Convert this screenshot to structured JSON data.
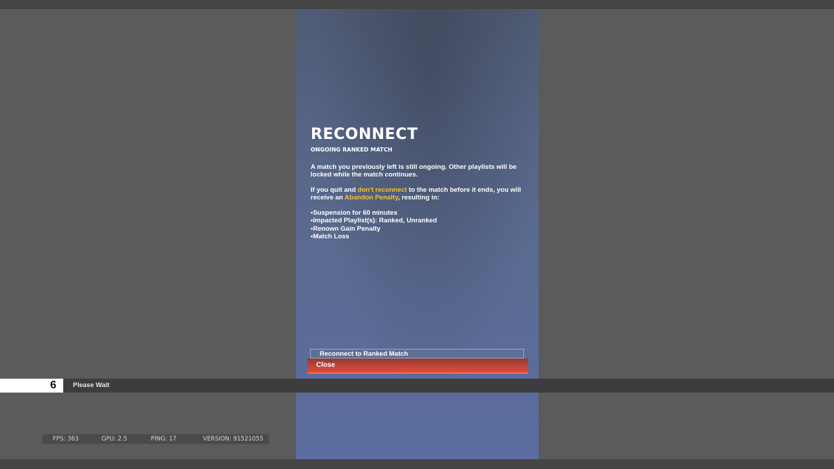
{
  "dialog": {
    "title": "RECONNECT",
    "subtitle": "ONGOING RANKED MATCH",
    "paragraph1": "A match you previously left is still ongoing. Other playlists will be locked while the match continues.",
    "paragraph2": {
      "part1": "If you quit and ",
      "highlight1": "don't reconnect",
      "part2": " to the match before it ends, you will receive an ",
      "highlight2": "Abandon Penalty",
      "part3": ", resulting in:"
    },
    "penalties": [
      "Suspension for 60 minutes",
      "Impacted Playlist(s): Ranked, Unranked",
      "Renown Gain Penalty",
      "Match Loss"
    ],
    "buttons": {
      "reconnect": "Reconnect to Ranked Match",
      "close": "Close"
    },
    "highlight_color": "#f2c230",
    "close_color": "#e24a3b"
  },
  "wait": {
    "count": "6",
    "label": "Please Wait"
  },
  "stats": {
    "fps": "FPS: 363",
    "gpu": "GPU: 2.5",
    "ping": "PING: 17",
    "version": "VERSION: 91521055"
  }
}
